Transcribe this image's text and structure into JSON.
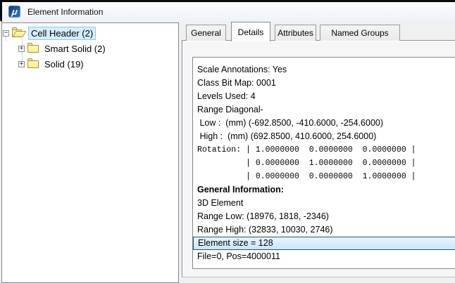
{
  "window": {
    "title": "Element Information",
    "icon": "microstation-logo",
    "icon_glyph": "μ"
  },
  "tree": {
    "items": [
      {
        "label": "Cell Header (2)",
        "level": 0,
        "expander": "−",
        "folder": "open",
        "selected": true
      },
      {
        "label": "Smart Solid (2)",
        "level": 1,
        "expander": "+",
        "folder": "closed",
        "selected": false
      },
      {
        "label": "Solid (19)",
        "level": 1,
        "expander": "+",
        "folder": "closed",
        "selected": false
      }
    ]
  },
  "tabs": [
    {
      "label": "General",
      "active": false
    },
    {
      "label": "Details",
      "active": true
    },
    {
      "label": "Attributes",
      "active": false
    },
    {
      "label": "Named Groups",
      "active": false
    }
  ],
  "details": {
    "lines": [
      {
        "text": "Scale Annotations: Yes"
      },
      {
        "text": "Class Bit Map: 0001"
      },
      {
        "text": "Levels Used: 4"
      },
      {
        "text": "Range Diagonal-"
      },
      {
        "text": " Low :  (mm) (-692.8500, -410.6000, -254.6000)"
      },
      {
        "text": " High :  (mm) (692.8500, 410.6000, 254.6000)"
      },
      {
        "text": "Rotation: | 1.0000000  0.0000000  0.0000000 |",
        "mono": true
      },
      {
        "text": "          | 0.0000000  1.0000000  0.0000000 |",
        "mono": true
      },
      {
        "text": "          | 0.0000000  0.0000000  1.0000000 |",
        "mono": true
      },
      {
        "text": "General Information:",
        "bold": true
      },
      {
        "text": "3D Element"
      },
      {
        "text": "Range Low: (18976, 1818, -2346)"
      },
      {
        "text": "Range High: (32833, 10030, 2746)"
      },
      {
        "text": "Element size = 128",
        "highlighted": true
      },
      {
        "text": "File=0, Pos=4000011"
      }
    ]
  },
  "colors": {
    "icon_blue": "#123c6e",
    "selection_fill": "#d5edfc",
    "selection_border": "#8bc9ef",
    "row_highlight_border": "#26536f",
    "row_highlight_fill_top": "#e7f5fd",
    "row_highlight_fill_bottom": "#c9e6f8",
    "folder_fill": "#fbf18e",
    "folder_border": "#a3922f"
  }
}
